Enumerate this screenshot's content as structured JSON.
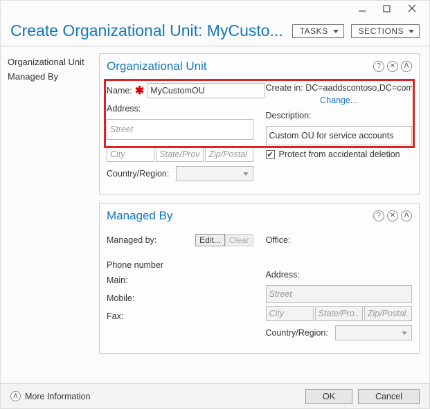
{
  "window": {
    "page_title": "Create Organizational Unit: MyCusto...",
    "tasks_btn": "TASKS",
    "sections_btn": "SECTIONS"
  },
  "sidebar": {
    "items": [
      "Organizational Unit",
      "Managed By"
    ]
  },
  "ou": {
    "title": "Organizational Unit",
    "name_label": "Name:",
    "name_value": "MyCustomOU",
    "address_label": "Address:",
    "street_ph": "Street",
    "city_ph": "City",
    "state_ph": "State/Provi...",
    "zip_ph": "Zip/Postal c...",
    "country_label": "Country/Region:",
    "createin_label": "Create in:",
    "createin_value": "DC=aaddscontoso,DC=com",
    "change_link": "Change...",
    "desc_label": "Description:",
    "desc_value": "Custom OU for service accounts",
    "protect_label": "Protect from accidental deletion"
  },
  "mb": {
    "title": "Managed By",
    "managedby_label": "Managed by:",
    "edit_btn": "Edit...",
    "clear_btn": "Clear",
    "phone_label": "Phone number",
    "main_label": "Main:",
    "mobile_label": "Mobile:",
    "fax_label": "Fax:",
    "office_label": "Office:",
    "address_label": "Address:",
    "street_ph": "Street",
    "city_ph": "City",
    "state_ph": "State/Pro...",
    "zip_ph": "Zip/Postal...",
    "country_label": "Country/Region:"
  },
  "bottom": {
    "more_info": "More Information",
    "ok": "OK",
    "cancel": "Cancel"
  },
  "icons": {
    "help": "?",
    "close": "✕",
    "collapse": "ᐱ",
    "expand": "ᐱ",
    "check": "✔"
  }
}
